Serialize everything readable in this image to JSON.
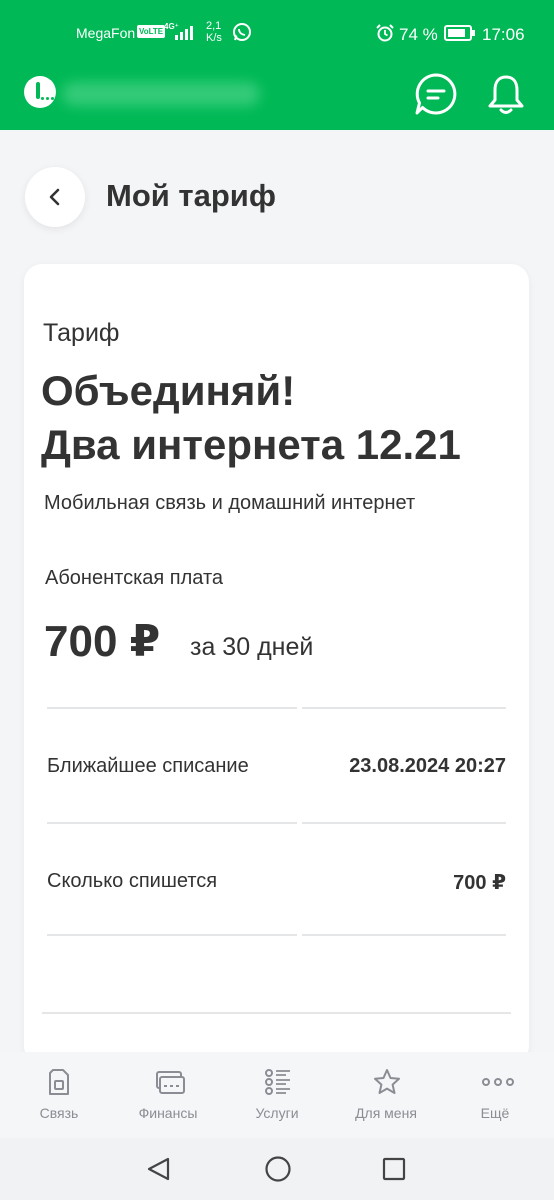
{
  "status_bar": {
    "carrier": "MegaFon",
    "volte": "VoLTE",
    "network": "4G⁺",
    "speed_value": "2,1",
    "speed_unit": "K/s",
    "battery": "74 %",
    "time": "17:06"
  },
  "header": {
    "brand_color": "#00b956"
  },
  "page": {
    "title": "Мой тариф"
  },
  "tariff": {
    "label": "Тариф",
    "name_line1": "Объединяй!",
    "name_line2": "Два интернета 12.21",
    "description": "Мобильная связь и домашний интернет",
    "fee_label": "Абонентская плата",
    "fee_amount": "700 ₽",
    "fee_period": "за 30 дней",
    "rows": [
      {
        "label": "Ближайшее списание",
        "value": "23.08.2024 20:27"
      },
      {
        "label": "Сколько спишется",
        "value": "700 ₽"
      }
    ]
  },
  "bottom_nav": {
    "items": [
      {
        "label": "Связь",
        "icon": "sim-card-icon"
      },
      {
        "label": "Финансы",
        "icon": "wallet-icon"
      },
      {
        "label": "Услуги",
        "icon": "services-list-icon"
      },
      {
        "label": "Для меня",
        "icon": "star-icon"
      },
      {
        "label": "Ещё",
        "icon": "more-dots-icon"
      }
    ]
  }
}
